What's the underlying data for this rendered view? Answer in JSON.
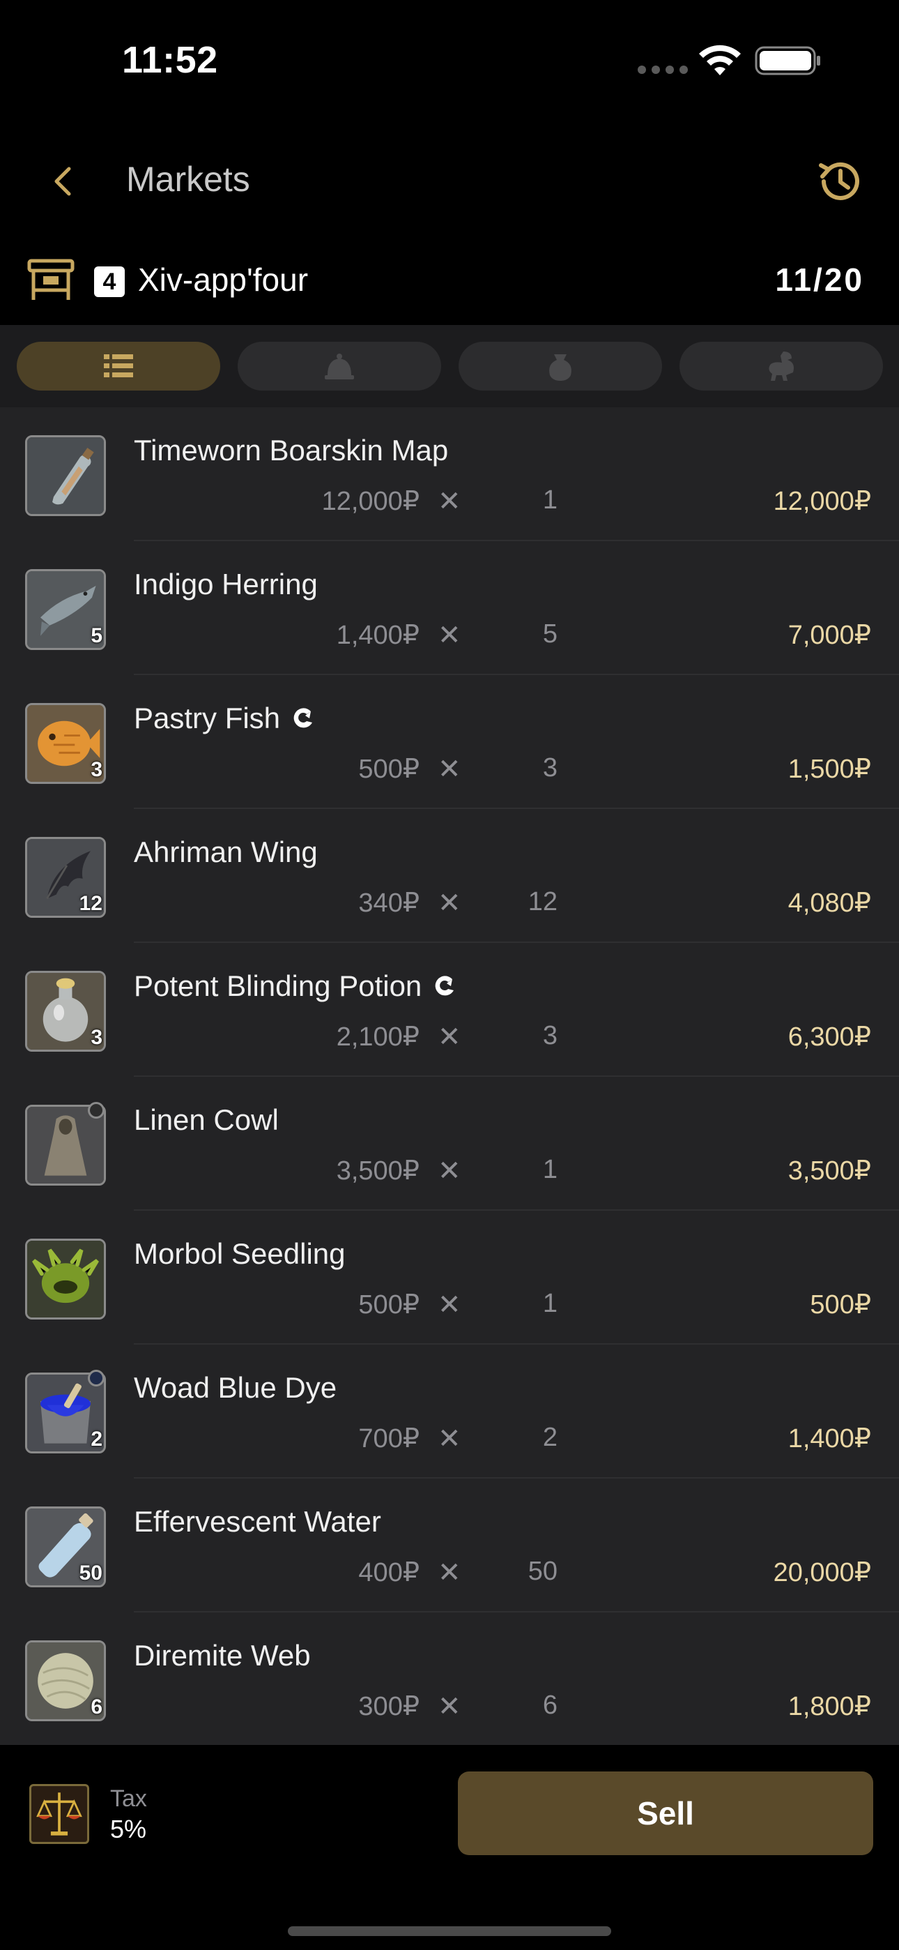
{
  "status_bar": {
    "time": "11:52"
  },
  "nav": {
    "title": "Markets"
  },
  "retainer": {
    "badge": "4",
    "name": "Xiv-app'four",
    "count": "11/20"
  },
  "tabs": [
    {
      "icon": "list-icon",
      "active": true
    },
    {
      "icon": "bell-icon",
      "active": false
    },
    {
      "icon": "bag-icon",
      "active": false
    },
    {
      "icon": "chocobo-icon",
      "active": false
    }
  ],
  "items": [
    {
      "name": "Timeworn Boarskin Map",
      "unit_price": "12,000₽",
      "quantity": "1",
      "total": "12,000₽",
      "stack": "",
      "hq": false,
      "icon": "bottle-map-icon"
    },
    {
      "name": "Indigo Herring",
      "unit_price": "1,400₽",
      "quantity": "5",
      "total": "7,000₽",
      "stack": "5",
      "hq": false,
      "icon": "fish-icon"
    },
    {
      "name": "Pastry Fish",
      "unit_price": "500₽",
      "quantity": "3",
      "total": "1,500₽",
      "stack": "3",
      "hq": true,
      "icon": "pastry-fish-icon"
    },
    {
      "name": "Ahriman Wing",
      "unit_price": "340₽",
      "quantity": "12",
      "total": "4,080₽",
      "stack": "12",
      "hq": false,
      "icon": "wing-icon"
    },
    {
      "name": "Potent Blinding Potion",
      "unit_price": "2,100₽",
      "quantity": "3",
      "total": "6,300₽",
      "stack": "3",
      "hq": true,
      "icon": "potion-icon"
    },
    {
      "name": "Linen Cowl",
      "unit_price": "3,500₽",
      "quantity": "1",
      "total": "3,500₽",
      "stack": "",
      "hq": false,
      "icon": "cowl-icon"
    },
    {
      "name": "Morbol Seedling",
      "unit_price": "500₽",
      "quantity": "1",
      "total": "500₽",
      "stack": "",
      "hq": false,
      "icon": "morbol-icon"
    },
    {
      "name": "Woad Blue Dye",
      "unit_price": "700₽",
      "quantity": "2",
      "total": "1,400₽",
      "stack": "2",
      "hq": false,
      "icon": "dye-icon"
    },
    {
      "name": "Effervescent Water",
      "unit_price": "400₽",
      "quantity": "50",
      "total": "20,000₽",
      "stack": "50",
      "hq": false,
      "icon": "water-bottle-icon"
    },
    {
      "name": "Diremite Web",
      "unit_price": "300₽",
      "quantity": "6",
      "total": "1,800₽",
      "stack": "6",
      "hq": false,
      "icon": "web-icon"
    }
  ],
  "footer": {
    "tax_label": "Tax",
    "tax_value": "5%",
    "sell_label": "Sell"
  },
  "colors": {
    "accent": "#c8a860",
    "total_text": "#ebd8a6",
    "sell_button": "#5a4a2a"
  }
}
